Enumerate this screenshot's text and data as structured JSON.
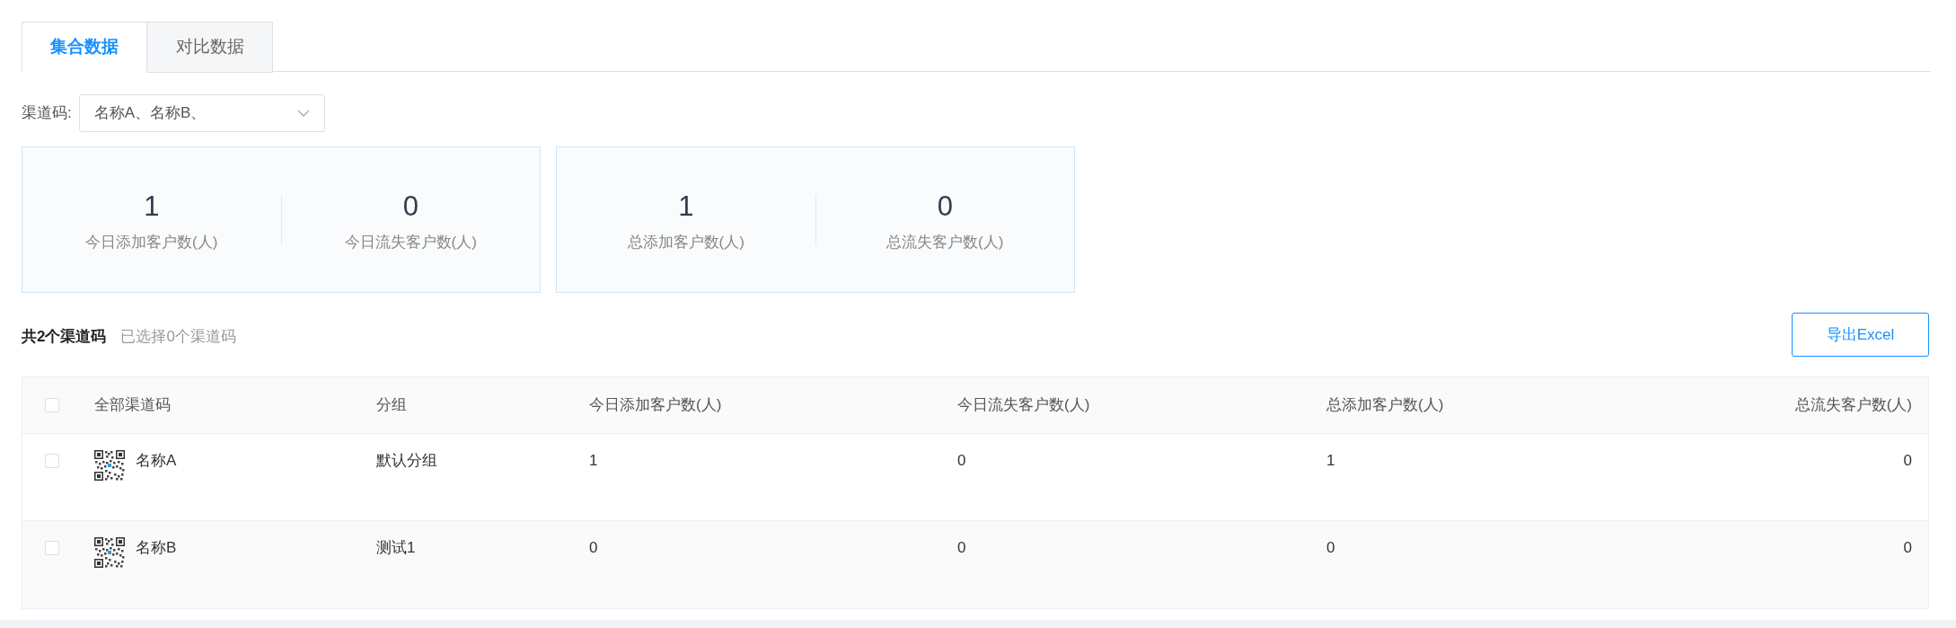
{
  "tabs": [
    {
      "label": "集合数据",
      "selected": true
    },
    {
      "label": "对比数据",
      "selected": false
    }
  ],
  "filter": {
    "label": "渠道码:",
    "value": "名称A、名称B、"
  },
  "stat_cards": [
    {
      "stats": [
        {
          "value": "1",
          "label": "今日添加客户数(人)"
        },
        {
          "value": "0",
          "label": "今日流失客户数(人)"
        }
      ]
    },
    {
      "stats": [
        {
          "value": "1",
          "label": "总添加客户数(人)"
        },
        {
          "value": "0",
          "label": "总流失客户数(人)"
        }
      ]
    }
  ],
  "summary": {
    "total": "共2个渠道码",
    "selected": "已选择0个渠道码"
  },
  "export_button": "导出Excel",
  "table": {
    "select_all_checked": false,
    "columns": [
      "全部渠道码",
      "分组",
      "今日添加客户数(人)",
      "今日流失客户数(人)",
      "总添加客户数(人)",
      "总流失客户数(人)"
    ],
    "rows": [
      {
        "checked": false,
        "cells": [
          "名称A",
          "默认分组",
          "1",
          "0",
          "1",
          "0"
        ]
      },
      {
        "checked": false,
        "cells": [
          "名称B",
          "测试1",
          "0",
          "0",
          "0",
          "0"
        ]
      }
    ]
  }
}
